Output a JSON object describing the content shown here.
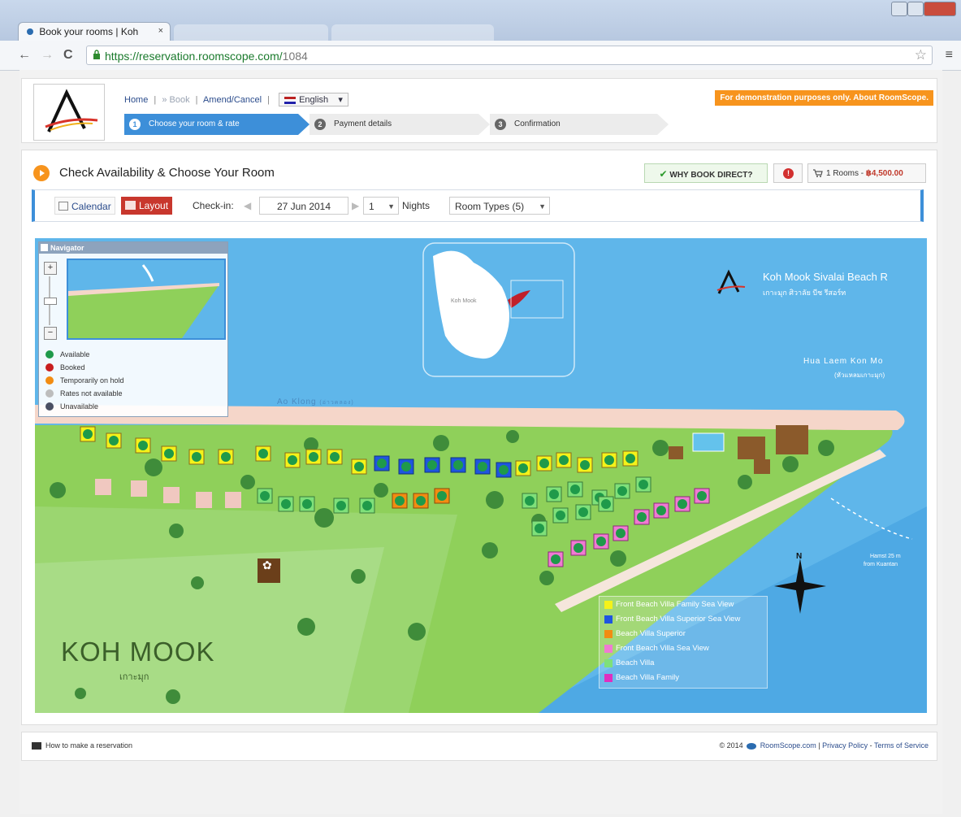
{
  "browser": {
    "tab_title": "Book your rooms | Koh",
    "tab_close": "×",
    "url_host": "https://reservation.roomscope.com/",
    "url_path": "1084",
    "back": "←",
    "forward": "→",
    "reload": "C",
    "star": "☆",
    "menu": "≡"
  },
  "header": {
    "home_link": "Home",
    "book_link": "» Book",
    "amend_link": "Amend/Cancel",
    "sep": "|",
    "language": "English",
    "lang_dd": "▾",
    "demo_banner": "For demonstration purposes only. About RoomScope.",
    "steps": [
      {
        "num": "1",
        "label": "Choose your room & rate"
      },
      {
        "num": "2",
        "label": "Payment details"
      },
      {
        "num": "3",
        "label": "Confirmation"
      }
    ]
  },
  "main": {
    "title": "Check Availability & Choose Your Room",
    "why_book": "WHY BOOK DIRECT?",
    "why_check": "✔",
    "info": "!",
    "cart_rooms": "1 Rooms - ",
    "cart_price": "฿4,500.00"
  },
  "filters": {
    "calendar": "Calendar",
    "layout": "Layout",
    "checkin_label": "Check-in:",
    "prev": "◀",
    "next": "▶",
    "date": "27 Jun 2014",
    "nights_value": "1",
    "nights_label": "Nights",
    "room_types": "Room Types (5)",
    "dd": "▼"
  },
  "map": {
    "navigator_title": "Navigator",
    "zoom_in": "+",
    "zoom_out": "−",
    "availability_legend": [
      {
        "label": "Available",
        "color": "#1f9a4a"
      },
      {
        "label": "Booked",
        "color": "#c81e1e"
      },
      {
        "label": "Temporarily on hold",
        "color": "#f28c12"
      },
      {
        "label": "Rates not available",
        "color": "#bdbdbd"
      },
      {
        "label": "Unavailable",
        "color": "#4a4f63"
      }
    ],
    "room_legend": [
      {
        "label": "Front Beach Villa Family Sea View",
        "color": "#f4f21a"
      },
      {
        "label": "Front Beach Villa Superior Sea View",
        "color": "#1f55e0"
      },
      {
        "label": "Beach Villa Superior",
        "color": "#f28c12"
      },
      {
        "label": "Front Beach Villa Sea View",
        "color": "#f07ad2"
      },
      {
        "label": "Beach Villa",
        "color": "#7fe07a"
      },
      {
        "label": "Beach Villa Family",
        "color": "#e02ec0"
      }
    ],
    "resort_name": "Koh Mook Sivalai Beach R",
    "resort_thai": "เกาะมุก ศิวาลัย บีช รีสอร์ท",
    "inset_label": "Koh Mook",
    "cape_name": "Hua Laem Kon Mo",
    "cape_thai": "(หัวแหลมเกาะมุก)",
    "bay_name": "Ao Klong",
    "bay_thai": "(อ่าวคลอง)",
    "boat_note": "Hamst 25 m",
    "boat_note2": "from Kuantan",
    "island_title": "KOH MOOK",
    "island_thai": "เกาะมุก",
    "compass_n": "N"
  },
  "footer": {
    "howto": "How to make a reservation",
    "copyright": "© 2014",
    "roomscope": "RoomScope.com",
    "sep": "|",
    "privacy": "Privacy Policy",
    "dash": "-",
    "terms": "Terms of Service"
  }
}
